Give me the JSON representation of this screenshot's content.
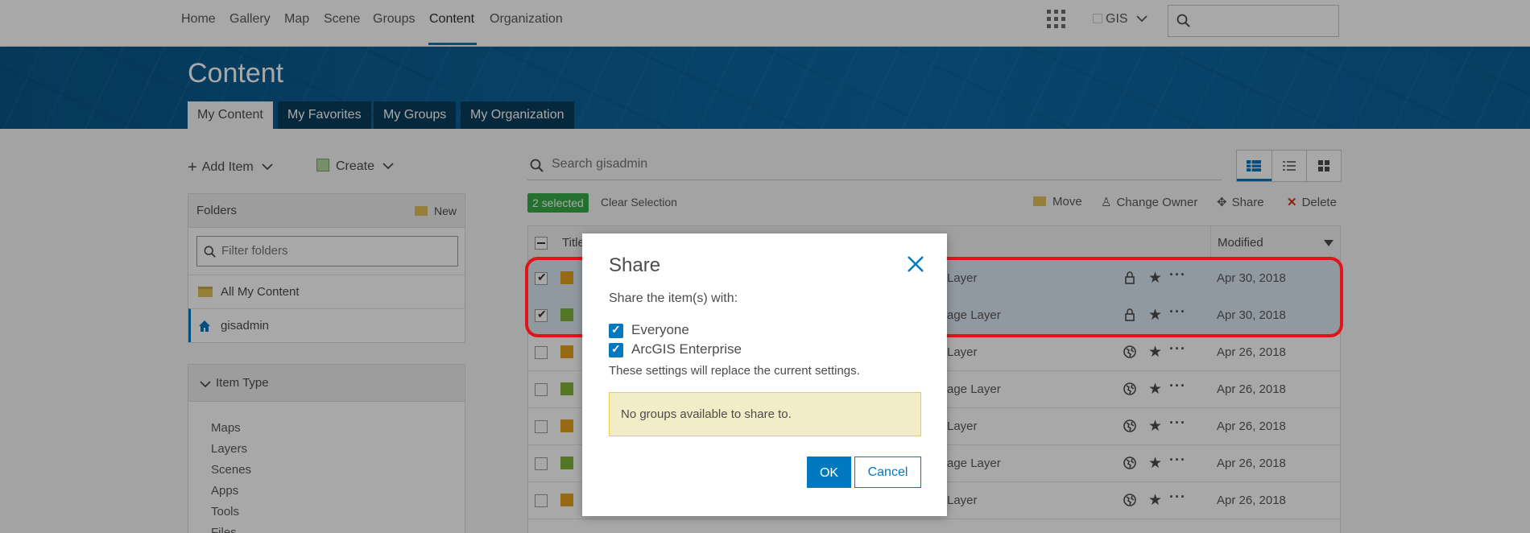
{
  "top_nav": {
    "links": [
      "Home",
      "Gallery",
      "Map",
      "Scene",
      "Groups",
      "Content",
      "Organization"
    ],
    "active": "Content",
    "user_label": "GIS",
    "search_placeholder": ""
  },
  "banner": {
    "title": "Content",
    "tabs": [
      "My Content",
      "My Favorites",
      "My Groups",
      "My Organization"
    ],
    "active_tab": "My Content"
  },
  "left_panel": {
    "add_item_label": "Add Item",
    "create_label": "Create",
    "folders": {
      "header": "Folders",
      "new_label": "New",
      "filter_placeholder": "Filter folders",
      "items": [
        {
          "label": "All My Content",
          "icon": "folders-icon"
        },
        {
          "label": "gisadmin",
          "icon": "home-icon",
          "selected": true
        }
      ]
    },
    "item_type": {
      "header": "Item Type",
      "types": [
        "Maps",
        "Layers",
        "Scenes",
        "Apps",
        "Tools",
        "Files"
      ]
    }
  },
  "content": {
    "search_placeholder": "Search gisadmin",
    "selected_badge": "2 selected",
    "clear_selection": "Clear Selection",
    "actions": [
      "Move",
      "Change Owner",
      "Share",
      "Delete"
    ],
    "columns": {
      "title": "Title",
      "modified": "Modified"
    },
    "rows": [
      {
        "type": "Layer",
        "access": "lock-icon",
        "modified": "Apr 30, 2018",
        "selected": true
      },
      {
        "type": "age Layer",
        "access": "lock-icon",
        "modified": "Apr 30, 2018",
        "selected": true
      },
      {
        "type": "Layer",
        "access": "globe-icon",
        "modified": "Apr 26, 2018",
        "selected": false
      },
      {
        "type": "age Layer",
        "access": "globe-icon",
        "modified": "Apr 26, 2018",
        "selected": false
      },
      {
        "type": "Layer",
        "access": "globe-icon",
        "modified": "Apr 26, 2018",
        "selected": false
      },
      {
        "type": "age Layer",
        "access": "globe-icon",
        "modified": "Apr 26, 2018",
        "selected": false
      },
      {
        "type": "Layer",
        "access": "globe-icon",
        "modified": "Apr 26, 2018",
        "selected": false
      }
    ]
  },
  "share_dialog": {
    "title": "Share",
    "subtitle": "Share the item(s) with:",
    "options": [
      {
        "label": "Everyone",
        "checked": true
      },
      {
        "label": "ArcGIS Enterprise",
        "checked": true
      }
    ],
    "note": "These settings will replace the current settings.",
    "alert": "No groups available to share to.",
    "ok_label": "OK",
    "cancel_label": "Cancel"
  },
  "colors": {
    "accent": "#0079c1",
    "banner": "#0b5f96",
    "highlight": "#e0151b",
    "selected_badge": "#35ac46",
    "alert_bg": "#f3edc7"
  }
}
